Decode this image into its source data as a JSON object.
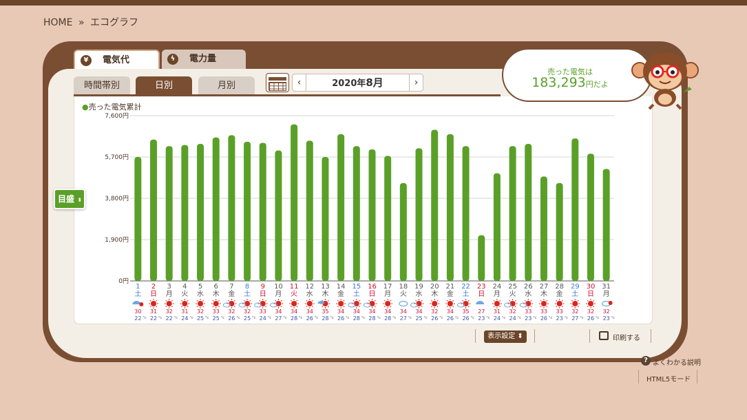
{
  "breadcrumb": {
    "home": "HOME",
    "separator": "»",
    "current": "エコグラフ"
  },
  "top_tabs": [
    {
      "label": "電気代",
      "icon": "yen-icon",
      "icon_glyph": "¥",
      "active": true
    },
    {
      "label": "電力量",
      "icon": "lightning-icon",
      "icon_glyph": "ϟ",
      "active": false
    }
  ],
  "sub_tabs": [
    {
      "label": "時間帯別",
      "active": false
    },
    {
      "label": "日別",
      "active": true
    },
    {
      "label": "月別",
      "active": false
    }
  ],
  "date_nav": {
    "year": "2020年",
    "month": "8月",
    "prev": "‹",
    "next": "›"
  },
  "bubble": {
    "label": "売った電気は",
    "value": "183,293",
    "unit": "円だよ"
  },
  "legend": {
    "marker": "●",
    "label": "売った電気累計"
  },
  "y_axis_button": {
    "label": "目盛",
    "arrows": "⬍"
  },
  "controls": {
    "display_settings": "表示設定",
    "display_arrows": "⬍",
    "print": "印刷する",
    "help": "よくわかる説明",
    "help_glyph": "?",
    "html5": "HTML5モード"
  },
  "colors": {
    "bar": "#5aa028",
    "saturday": "#3a7bd5",
    "sunday": "#c8102e",
    "weekday": "#555555",
    "high_temp": "#c8102e",
    "low_temp": "#3a52a5",
    "sun": "#d9261c",
    "rain": "#6fa6e0"
  },
  "chart_data": {
    "type": "bar",
    "title": "",
    "ylabel": "",
    "y_ticks": [
      "0円",
      "1,900円",
      "3,800円",
      "5,700円",
      "7,600円"
    ],
    "ylim": [
      0,
      7600
    ],
    "categories": [
      "1",
      "2",
      "3",
      "4",
      "5",
      "6",
      "7",
      "8",
      "9",
      "10",
      "11",
      "12",
      "13",
      "14",
      "15",
      "16",
      "17",
      "18",
      "19",
      "20",
      "21",
      "22",
      "23",
      "24",
      "25",
      "26",
      "27",
      "28",
      "29",
      "30",
      "31"
    ],
    "weekdays": [
      "土",
      "日",
      "月",
      "火",
      "水",
      "木",
      "金",
      "土",
      "日",
      "月",
      "火",
      "水",
      "木",
      "金",
      "土",
      "日",
      "月",
      "火",
      "水",
      "木",
      "金",
      "土",
      "日",
      "月",
      "火",
      "水",
      "木",
      "金",
      "土",
      "日",
      "月"
    ],
    "day_type": [
      "sat",
      "sun",
      "wd",
      "wd",
      "wd",
      "wd",
      "wd",
      "sat",
      "sun",
      "wd",
      "sun",
      "wd",
      "wd",
      "wd",
      "sat",
      "sun",
      "wd",
      "wd",
      "wd",
      "wd",
      "wd",
      "sat",
      "sun",
      "wd",
      "wd",
      "wd",
      "wd",
      "wd",
      "sat",
      "sun",
      "wd"
    ],
    "series": [
      {
        "values": [
          5700,
          6500,
          6200,
          6250,
          6300,
          6600,
          6700,
          6400,
          6350,
          6000,
          7200,
          6450,
          5700,
          6750,
          6200,
          6050,
          5750,
          4500,
          6100,
          6950,
          6750,
          6200,
          2100,
          4950,
          6200,
          6300,
          4800,
          4500,
          6550,
          5850,
          5150
        ]
      }
    ],
    "weather": [
      "rain-sun",
      "sun",
      "sun",
      "sun",
      "sun",
      "sun",
      "sun-cloud",
      "sun-cloud",
      "sun-cloud",
      "sun-cloud",
      "sun",
      "sun",
      "sun-rain",
      "sun",
      "sun-cloud",
      "sun-cloud",
      "sun",
      "cloud",
      "sun-cloud",
      "sun",
      "sun",
      "sun-cloud",
      "rain",
      "sun",
      "sun-cloud",
      "sun-cloud",
      "sun",
      "sun",
      "sun",
      "sun",
      "cloud-sun"
    ],
    "high_temp": [
      "30",
      "31",
      "32",
      "31",
      "32",
      "33",
      "32",
      "32",
      "33",
      "34",
      "34",
      "34",
      "35",
      "34",
      "34",
      "34",
      "34",
      "34",
      "34",
      "32",
      "34",
      "35",
      "27",
      "31",
      "32",
      "33",
      "33",
      "33",
      "32",
      "32",
      "32"
    ],
    "low_temp": [
      "22",
      "22",
      "22",
      "24",
      "25",
      "25",
      "26",
      "25",
      "24",
      "27",
      "28",
      "26",
      "28",
      "26",
      "28",
      "28",
      "28",
      "27",
      "25",
      "26",
      "26",
      "26",
      "23",
      "24",
      "24",
      "23",
      "26",
      "23",
      "27",
      "26",
      "23"
    ],
    "temp_unit": "°c",
    "grid": true
  }
}
